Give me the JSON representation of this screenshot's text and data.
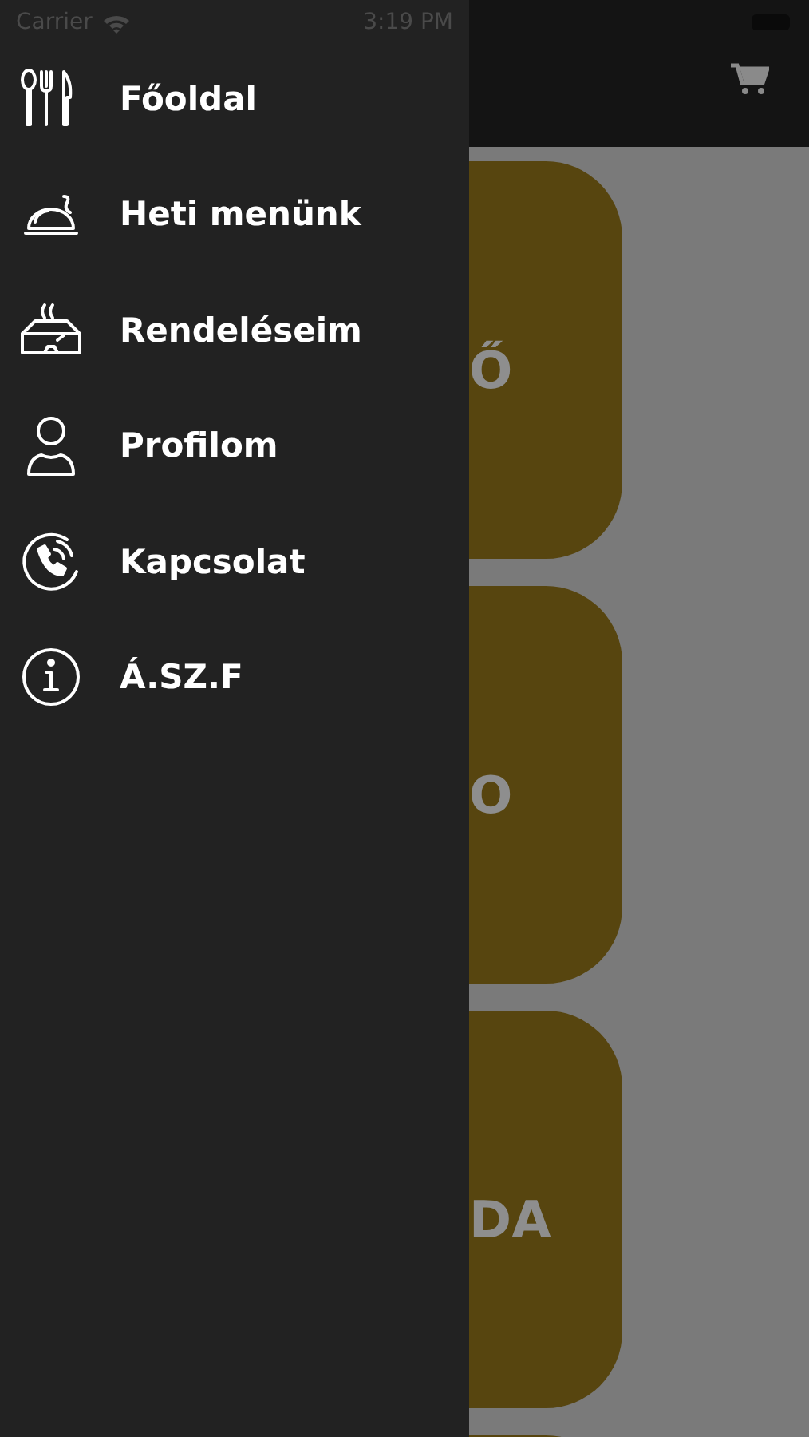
{
  "status_bar": {
    "carrier": "Carrier",
    "time": "3:19 PM"
  },
  "drawer": {
    "items": [
      {
        "kind": "cutlery",
        "label": "Főoldal"
      },
      {
        "kind": "cloche",
        "label": "Heti menünk"
      },
      {
        "kind": "box",
        "label": "Rendeléseim"
      },
      {
        "kind": "person",
        "label": "Profilom"
      },
      {
        "kind": "phone",
        "label": "Kapcsolat"
      },
      {
        "kind": "info",
        "label": "Á.SZ.F"
      }
    ]
  },
  "main": {
    "cards": [
      {
        "kind": "category",
        "label": "Ő"
      },
      {
        "kind": "category",
        "label": "O"
      },
      {
        "kind": "category",
        "label": "DA"
      },
      {
        "kind": "category"
      }
    ]
  }
}
